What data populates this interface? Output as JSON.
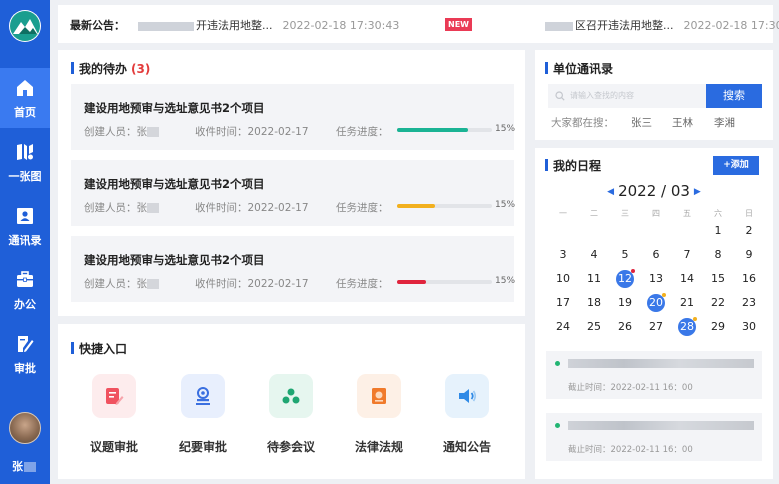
{
  "sidebar": {
    "items": [
      {
        "label": "首页",
        "icon": "home-icon"
      },
      {
        "label": "一张图",
        "icon": "map-icon"
      },
      {
        "label": "通讯录",
        "icon": "contacts-icon"
      },
      {
        "label": "办公",
        "icon": "briefcase-icon"
      },
      {
        "label": "审批",
        "icon": "approval-icon"
      }
    ],
    "user_name": "张"
  },
  "notice": {
    "label": "最新公告：",
    "items": [
      {
        "title": "开违法用地整...",
        "time": "2022-02-18 17:30:43",
        "badge": "NEW"
      },
      {
        "title": "区召开违法用地整...",
        "time": "2022-02-18 17:30:43"
      }
    ]
  },
  "todo": {
    "title": "我的待办",
    "count": "(3)",
    "tasks": [
      {
        "title": "建设用地预审与选址意见书2个项目",
        "creator": "创建人员：张",
        "received": "收件时间：2022-02-17",
        "progress_label": "任务进度：",
        "progress": 0.75,
        "percent": "15%",
        "color": "#1ab394"
      },
      {
        "title": "建设用地预审与选址意见书2个项目",
        "creator": "创建人员：张",
        "received": "收件时间：2022-02-17",
        "progress_label": "任务进度：",
        "progress": 0.4,
        "percent": "15%",
        "color": "#f2b01e"
      },
      {
        "title": "建设用地预审与选址意见书2个项目",
        "creator": "创建人员：张",
        "received": "收件时间：2022-02-17",
        "progress_label": "任务进度：",
        "progress": 0.3,
        "percent": "15%",
        "color": "#e0243d"
      }
    ]
  },
  "quick": {
    "title": "快捷入口",
    "items": [
      {
        "label": "议题审批",
        "icon": "topic-approval-icon",
        "bg": "#fdeced",
        "color": "#f0525f"
      },
      {
        "label": "纪要审批",
        "icon": "minutes-approval-icon",
        "bg": "#e8effd",
        "color": "#3a6fe0"
      },
      {
        "label": "待参会议",
        "icon": "meeting-icon",
        "bg": "#e6f6ef",
        "color": "#1fa672"
      },
      {
        "label": "法律法规",
        "icon": "law-icon",
        "bg": "#fdf0e6",
        "color": "#f07a2b"
      },
      {
        "label": "通知公告",
        "icon": "announcement-icon",
        "bg": "#e6f2fc",
        "color": "#2f8ae6"
      }
    ]
  },
  "contacts": {
    "title": "单位通讯录",
    "search_placeholder": "请输入查找的内容",
    "search_button": "搜索",
    "hot_label": "大家都在搜：",
    "hot_names": [
      "张三",
      "王林",
      "李湘"
    ]
  },
  "schedule": {
    "title": "我的日程",
    "add_button": "+添加",
    "month_label": "2022 / 03",
    "weekdays": [
      "一",
      "二",
      "三",
      "四",
      "五",
      "六",
      "日"
    ],
    "weeks": [
      [
        "",
        "",
        "",
        "",
        "",
        "1",
        "2"
      ],
      [
        "3",
        "4",
        "5",
        "6",
        "7",
        "8",
        "9"
      ],
      [
        "10",
        "11",
        "12",
        "13",
        "14",
        "15",
        "16"
      ],
      [
        "17",
        "18",
        "19",
        "20",
        "21",
        "22",
        "23"
      ],
      [
        "24",
        "25",
        "26",
        "27",
        "28",
        "29",
        "30"
      ]
    ],
    "highlighted_days": [
      {
        "day": "12",
        "dot_color": "#e0243d"
      },
      {
        "day": "20",
        "dot_color": "#f2b01e"
      },
      {
        "day": "28",
        "dot_color": "#f2b01e"
      }
    ],
    "events": [
      {
        "deadline": "截止时间：2022-02-11  16：00"
      },
      {
        "deadline": "截止时间：2022-02-11  16：00"
      }
    ]
  },
  "colors": {
    "sidebar": "#1f5fd8",
    "accent": "#2a6be0",
    "badge": "#ea3a55"
  }
}
